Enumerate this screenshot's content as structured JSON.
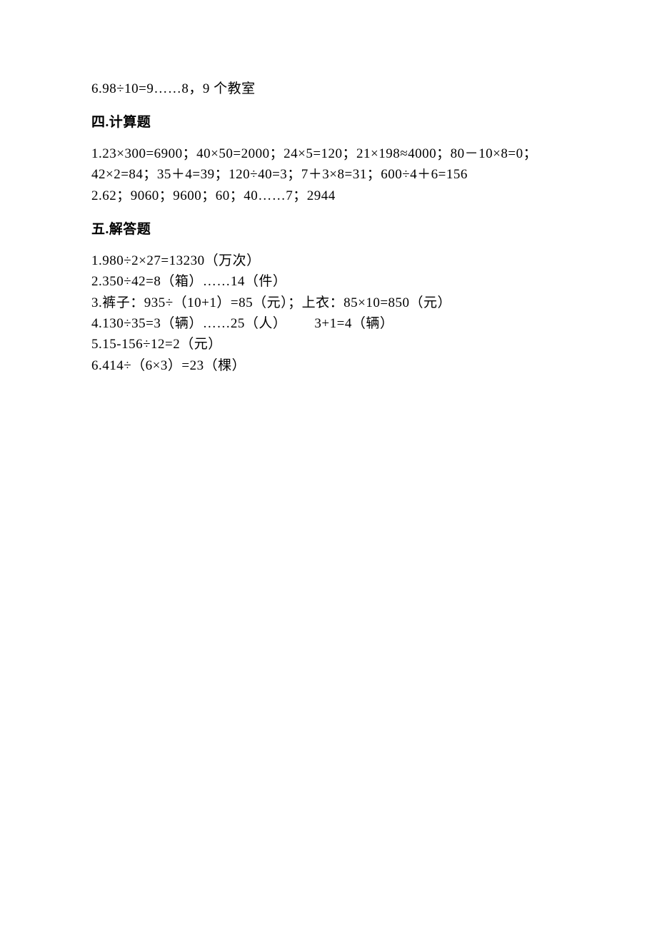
{
  "first_line": "6.98÷10=9……8，9 个教室",
  "section4": {
    "heading": "四.计算题",
    "lines": [
      "1.23×300=6900；40×50=2000；24×5=120；21×198≈4000；80－10×8=0；",
      "42×2=84；35＋4=39；120÷40=3；7＋3×8=31；600÷4＋6=156",
      "2.62；9060；9600；60；40……7；2944"
    ]
  },
  "section5": {
    "heading": "五.解答题",
    "lines": [
      "1.980÷2×27=13230（万次）",
      "2.350÷42=8（箱）……14（件）",
      "3.裤子：935÷（10+1）=85（元）；上衣：85×10=850（元）",
      "4.130÷35=3（辆）……25（人）  3+1=4（辆）",
      "5.15-156÷12=2（元）",
      "6.414÷（6×3）=23（棵）"
    ]
  }
}
